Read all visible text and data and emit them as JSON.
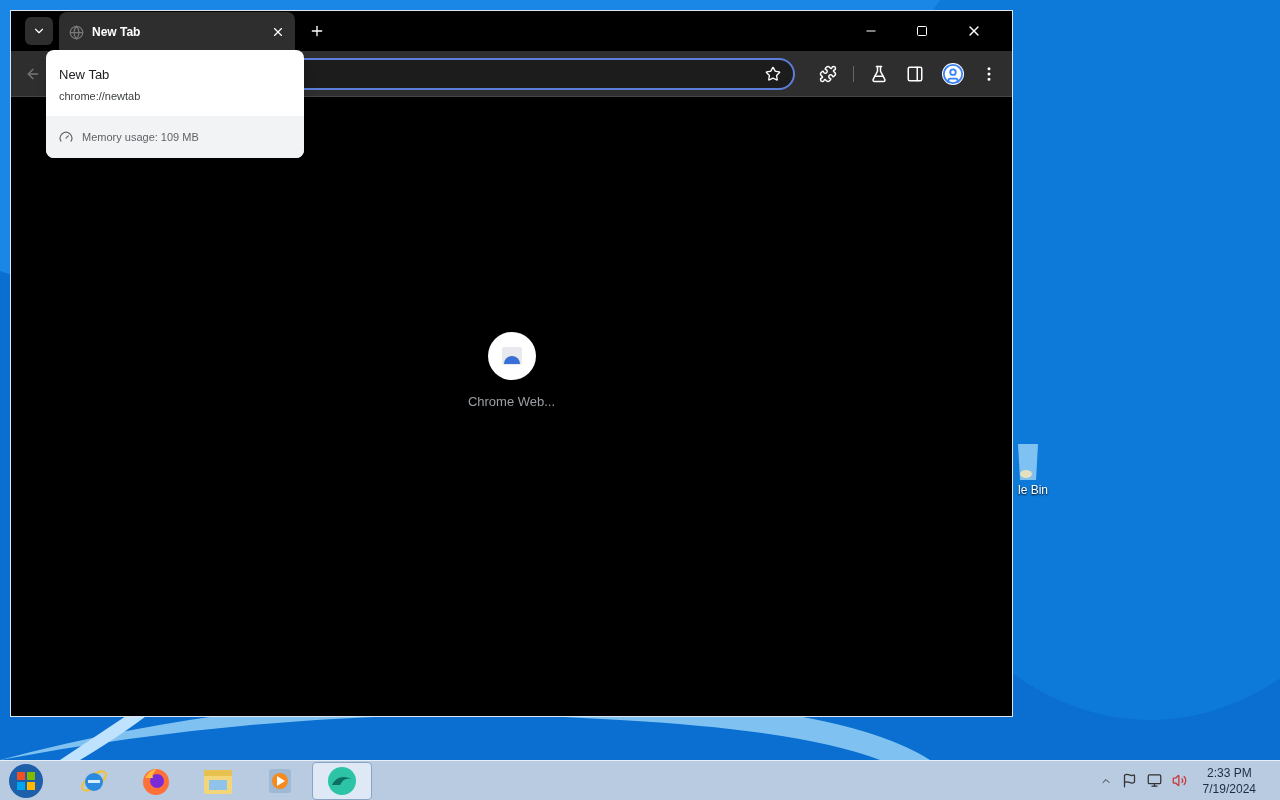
{
  "browser": {
    "tabs": [
      {
        "title": "New Tab",
        "selected": true
      }
    ],
    "hover_card": {
      "title": "New Tab",
      "url": "chrome://newtab",
      "memory": "Memory usage: 109 MB"
    },
    "shortcuts": [
      {
        "label": "Chrome Web..."
      }
    ]
  },
  "desktop_icons": [
    {
      "label": "le Bin"
    }
  ],
  "taskbar": {
    "apps": [
      {
        "kind": "ie",
        "selected": false
      },
      {
        "kind": "firefox",
        "selected": false
      },
      {
        "kind": "explorer",
        "selected": false
      },
      {
        "kind": "media",
        "selected": false
      },
      {
        "kind": "edge",
        "selected": true
      }
    ],
    "time": "2:33 PM",
    "date": "7/19/2024"
  }
}
